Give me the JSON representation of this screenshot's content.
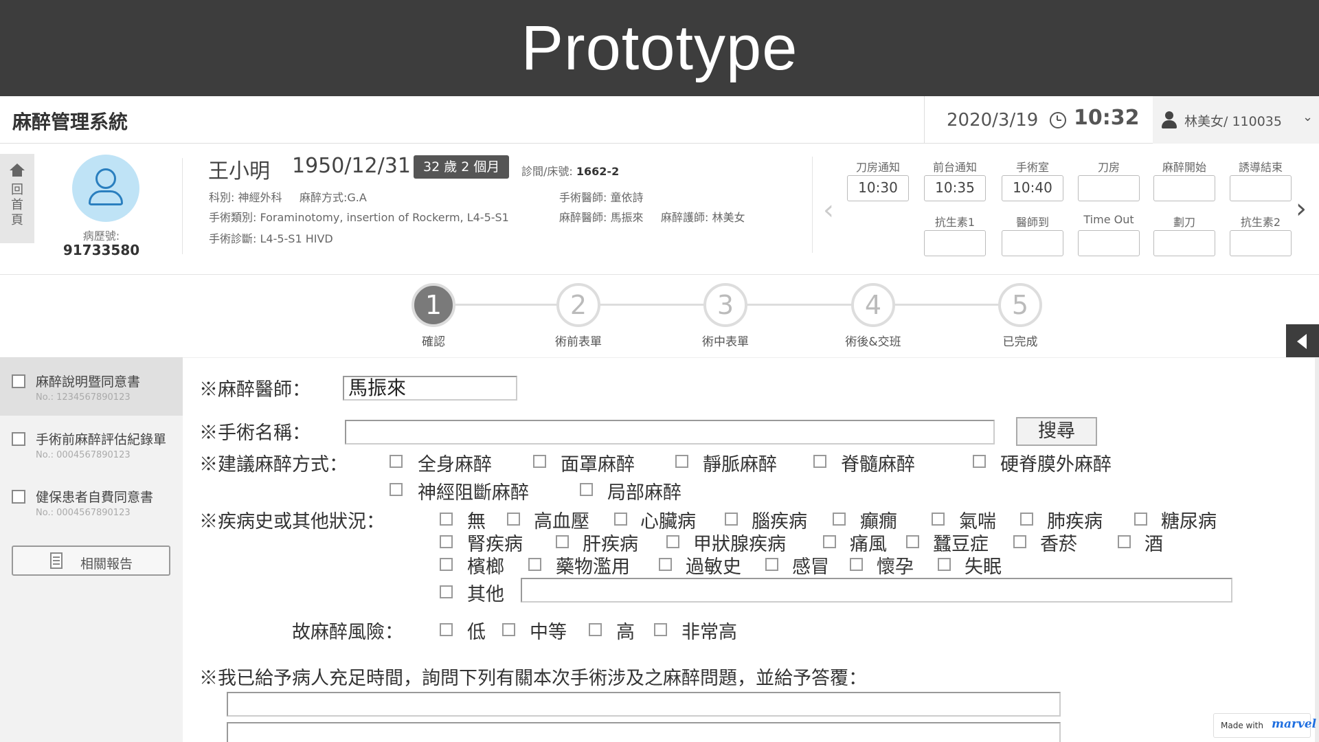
{
  "banner": {
    "title": "Prototype"
  },
  "header": {
    "app_name": "麻醉管理系統",
    "date": "2020/3/19",
    "time": "10:32",
    "user": "林美女/ 110035",
    "home_label": [
      "回",
      "首",
      "頁"
    ]
  },
  "patient": {
    "mrn_label": "病歷號:",
    "mrn": "91733580",
    "name": "王小明",
    "dob": "1950/12/31",
    "age": "32 歲 2 個月",
    "bed_label": "診間/床號:",
    "bed": "1662-2",
    "department": "科別: 神經外科",
    "anesthesia_method": "麻醉方式:G.A",
    "surgery_type": "手術類別: Foraminotomy, insertion of Rockerm, L4-5-S1",
    "diagnosis": "手術診斷: L4-5-S1 HIVD",
    "surgeon": "手術醫師: 童依詩",
    "anesthesiologist": "麻醉醫師: 馬振來",
    "nurse": "麻醉護師: 林美女"
  },
  "timeline": {
    "row1": [
      {
        "label": "刀房通知",
        "value": "10:30"
      },
      {
        "label": "前台通知",
        "value": "10:35"
      },
      {
        "label": "手術室",
        "value": "10:40"
      },
      {
        "label": "刀房",
        "value": ""
      },
      {
        "label": "麻醉開始",
        "value": ""
      },
      {
        "label": "誘導結束",
        "value": ""
      }
    ],
    "row2": [
      {
        "label": "抗生素1",
        "value": ""
      },
      {
        "label": "醫師到",
        "value": ""
      },
      {
        "label": "Time Out",
        "value": ""
      },
      {
        "label": "劃刀",
        "value": ""
      },
      {
        "label": "抗生素2",
        "value": ""
      }
    ]
  },
  "stepper": {
    "active": 1,
    "steps": [
      {
        "num": "1",
        "label": "確認"
      },
      {
        "num": "2",
        "label": "術前表單"
      },
      {
        "num": "3",
        "label": "術中表單"
      },
      {
        "num": "4",
        "label": "術後&交班"
      },
      {
        "num": "5",
        "label": "已完成"
      }
    ]
  },
  "sidebar": {
    "docs": [
      {
        "title": "麻醉說明暨同意書",
        "no": "No.: 1234567890123"
      },
      {
        "title": "手術前麻醉評估紀錄單",
        "no": "No.: 0004567890123"
      },
      {
        "title": "健保患者自費同意書",
        "no": "No.: 0004567890123"
      }
    ],
    "report_button": "相關報告"
  },
  "form": {
    "anesthesiologist_label": "※麻醉醫師：",
    "anesthesiologist_value": "馬振來",
    "surgery_name_label": "※手術名稱：",
    "surgery_name_value": "",
    "search_button": "搜尋",
    "method_label": "※建議麻醉方式：",
    "methods": [
      "全身麻醉",
      "面罩麻醉",
      "靜脈麻醉",
      "脊髓麻醉",
      "硬脊膜外麻醉",
      "神經阻斷麻醉",
      "局部麻醉"
    ],
    "history_label": "※疾病史或其他狀況：",
    "conditions": [
      "無",
      "高血壓",
      "心臟病",
      "腦疾病",
      "癲癇",
      "氣喘",
      "肺疾病",
      "糖尿病",
      "腎疾病",
      "肝疾病",
      "甲狀腺疾病",
      "痛風",
      "蠶豆症",
      "香菸",
      "酒",
      "檳榔",
      "藥物濫用",
      "過敏史",
      "感冒",
      "懷孕",
      "失眠",
      "其他"
    ],
    "other_value": "",
    "risk_label": "故麻醉風險：",
    "risks": [
      "低",
      "中等",
      "高",
      "非常高"
    ],
    "consent_statement": "※我已給予病人充足時間，詢問下列有關本次手術涉及之麻醉問題，並給予答覆："
  },
  "footer": {
    "made_with": "Made with",
    "brand": "marvel"
  }
}
